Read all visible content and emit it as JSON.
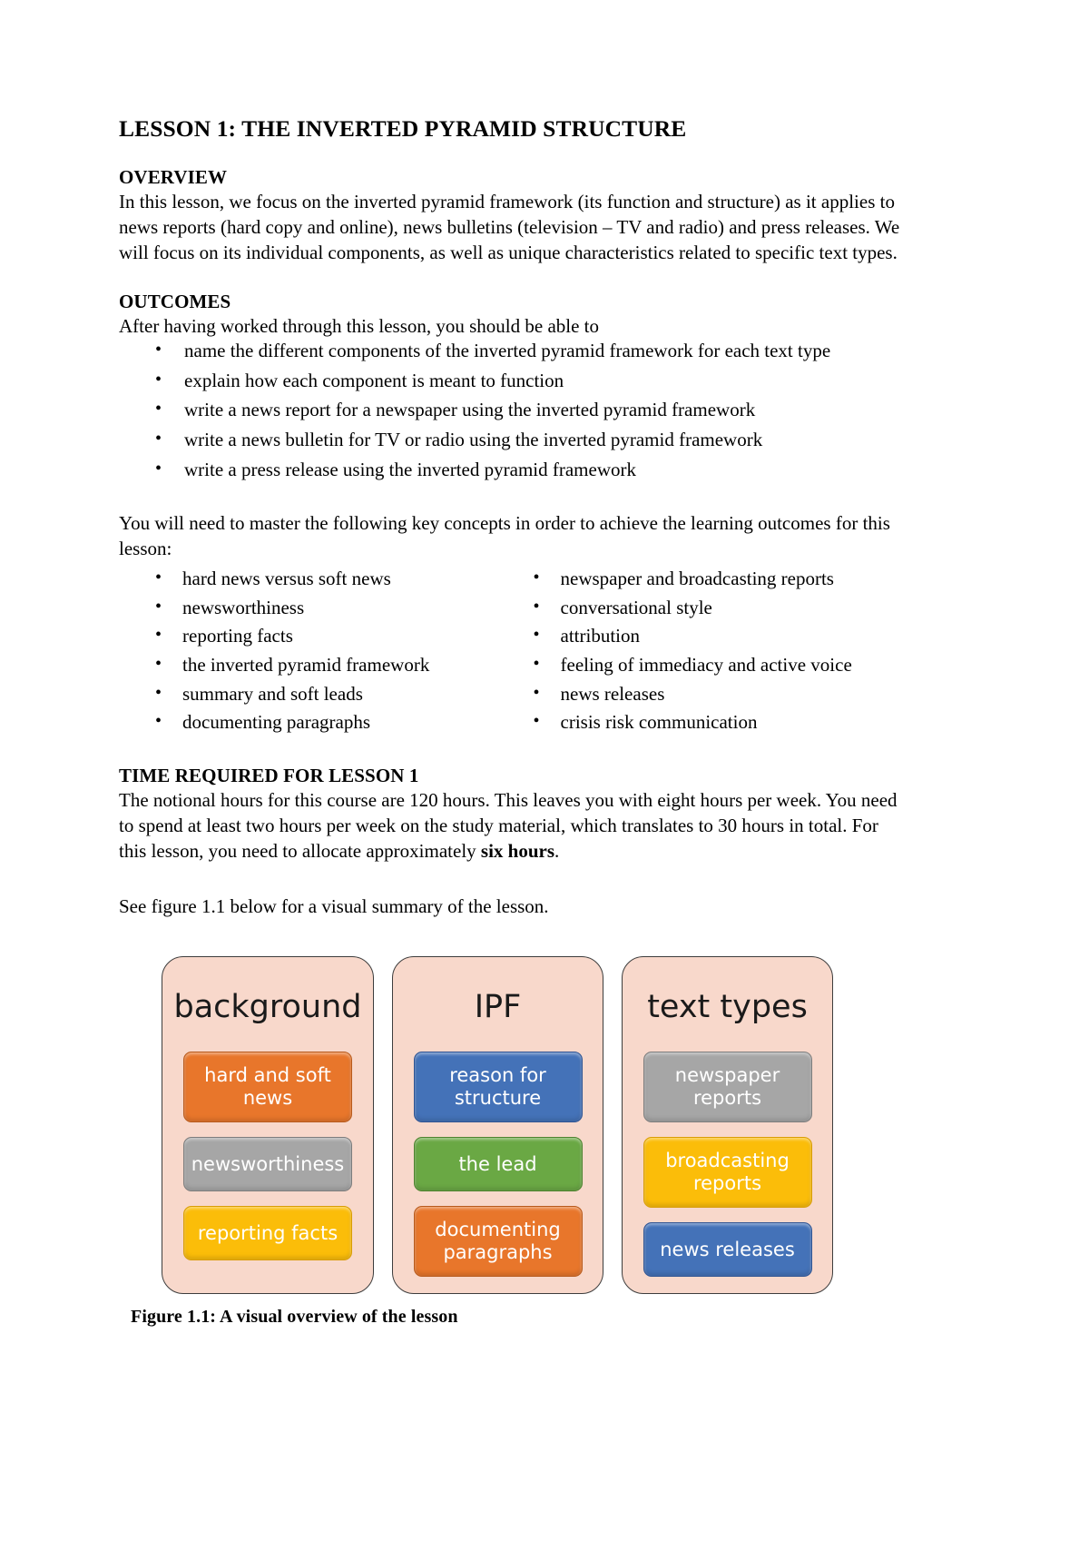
{
  "document": {
    "title": "LESSON 1: THE INVERTED PYRAMID STRUCTURE",
    "sections": {
      "overview": {
        "heading": "OVERVIEW",
        "paragraph": "In this lesson, we focus on the inverted pyramid framework (its function and structure) as it applies to news reports (hard copy and online), news bulletins (television – TV and radio) and press releases. We will focus on its individual components, as well as unique characteristics related to specific text types."
      },
      "outcomes": {
        "heading": "OUTCOMES",
        "intro": "After having worked through this lesson, you should be able to",
        "items": [
          "name the different components of the inverted pyramid framework for each text type",
          "explain how each component is meant to function",
          "write a news report for a newspaper using the inverted pyramid framework",
          "write a news bulletin for TV or radio using the inverted pyramid framework",
          "write a press release using the inverted pyramid framework"
        ]
      },
      "key_concepts": {
        "intro": "You will need to master the following key concepts in order to achieve the learning outcomes for this lesson:",
        "left_column": [
          "hard news versus soft news",
          "newsworthiness",
          "reporting facts",
          "the inverted pyramid framework",
          "summary and soft leads",
          "documenting paragraphs"
        ],
        "right_column": [
          "newspaper and broadcasting reports",
          "conversational style",
          "attribution",
          "feeling of immediacy and active voice",
          "news releases",
          "crisis risk communication"
        ]
      },
      "time_required": {
        "heading": "TIME REQUIRED FOR LESSON 1",
        "text_before_bold": "The notional hours for this course are 120 hours. This leaves you with eight hours per week. You need to spend at least two hours per week on the study material, which translates to 30 hours in total. For this lesson, you need to allocate approximately ",
        "bold_text": "six hours",
        "text_after_bold": "."
      },
      "figure_intro": "See figure 1.1 below for a visual summary of the lesson."
    },
    "figure": {
      "caption": "Figure 1.1: A visual overview of the lesson",
      "container_color": "#f8d8cb",
      "groups": [
        {
          "title": "background",
          "nodes": [
            {
              "label": "hard and soft news",
              "color": "#e8762b",
              "color_name": "orange"
            },
            {
              "label": "newsworthiness",
              "color": "#a6a6a6",
              "color_name": "gray"
            },
            {
              "label": "reporting facts",
              "color": "#fbbd09",
              "color_name": "yellow"
            }
          ]
        },
        {
          "title": "IPF",
          "nodes": [
            {
              "label": "reason for structure",
              "color": "#4472b8",
              "color_name": "blue"
            },
            {
              "label": "the lead",
              "color": "#6aa844",
              "color_name": "green"
            },
            {
              "label": "documenting paragraphs",
              "color": "#e8762b",
              "color_name": "orange"
            }
          ]
        },
        {
          "title": "text types",
          "nodes": [
            {
              "label": "newspaper reports",
              "color": "#a6a6a6",
              "color_name": "gray"
            },
            {
              "label": "broadcasting reports",
              "color": "#fbbd09",
              "color_name": "yellow"
            },
            {
              "label": "news releases",
              "color": "#4472b8",
              "color_name": "blue"
            }
          ]
        }
      ]
    }
  }
}
